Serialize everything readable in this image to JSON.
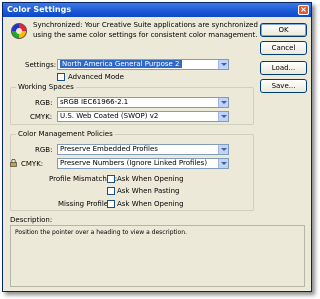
{
  "window": {
    "title": "Color Settings",
    "close": "×"
  },
  "sync": {
    "message": "Synchronized: Your Creative Suite applications are synchronized using the same color settings for consistent color management."
  },
  "buttons": {
    "ok": "OK",
    "cancel": "Cancel",
    "load": "Load...",
    "save": "Save..."
  },
  "settings": {
    "label": "Settings:",
    "value": "North America General Purpose 2"
  },
  "advanced_mode": {
    "label": "Advanced Mode",
    "checked": false
  },
  "working_spaces": {
    "title": "Working Spaces",
    "rgb_label": "RGB:",
    "rgb_value": "sRGB IEC61966-2.1",
    "cmyk_label": "CMYK:",
    "cmyk_value": "U.S. Web Coated (SWOP) v2"
  },
  "policies": {
    "title": "Color Management Policies",
    "rgb_label": "RGB:",
    "rgb_value": "Preserve Embedded Profiles",
    "cmyk_label": "CMYK:",
    "cmyk_value": "Preserve Numbers (Ignore Linked Profiles)",
    "profile_mismatches_label": "Profile Mismatches:",
    "ask_opening": "Ask When Opening",
    "ask_pasting": "Ask When Pasting",
    "missing_profiles_label": "Missing Profiles:",
    "ask_opening_missing": "Ask When Opening"
  },
  "description": {
    "label": "Description:",
    "text": "Position the pointer over a heading to view a description."
  }
}
